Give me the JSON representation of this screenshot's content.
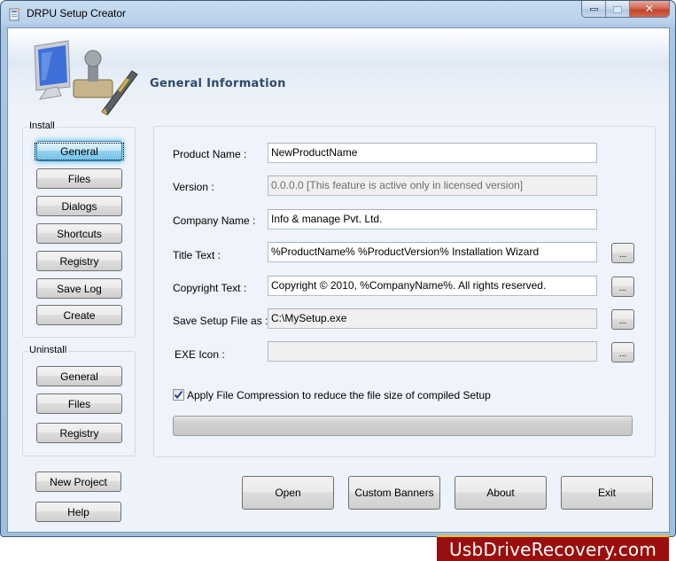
{
  "window": {
    "title": "DRPU Setup Creator",
    "controls": {
      "minimize": "minimize",
      "maximize": "maximize",
      "close": "close"
    }
  },
  "header": {
    "title": "General Information",
    "art_icons": [
      "monitor-icon",
      "stamp-icon",
      "pen-icon"
    ]
  },
  "sidebar": {
    "install": {
      "label": "Install",
      "items": [
        {
          "label": "General",
          "active": true
        },
        {
          "label": "Files"
        },
        {
          "label": "Dialogs"
        },
        {
          "label": "Shortcuts"
        },
        {
          "label": "Registry"
        },
        {
          "label": "Save Log"
        },
        {
          "label": "Create"
        }
      ]
    },
    "uninstall": {
      "label": "Uninstall",
      "items": [
        {
          "label": "General"
        },
        {
          "label": "Files"
        },
        {
          "label": "Registry"
        }
      ]
    },
    "new_project": "New Project",
    "help": "Help"
  },
  "form": {
    "product_name": {
      "label": "Product Name :",
      "value": "NewProductName"
    },
    "version": {
      "label": "Version :",
      "value": "0.0.0.0 [This feature is active only in licensed version]",
      "disabled": true
    },
    "company_name": {
      "label": "Company Name :",
      "value": "Info & manage Pvt. Ltd."
    },
    "title_text": {
      "label": "Title Text :",
      "value": "%ProductName% %ProductVersion% Installation Wizard",
      "browse": "..."
    },
    "copyright_text": {
      "label": "Copyright Text :",
      "value": "Copyright © 2010, %CompanyName%. All rights reserved.",
      "browse": "..."
    },
    "save_setup": {
      "label": "Save Setup File as :",
      "value": "C:\\MySetup.exe",
      "browse": "...",
      "disabled": true
    },
    "exe_icon": {
      "label": "EXE Icon :",
      "value": "",
      "browse": "...",
      "disabled": true
    },
    "compression": {
      "label": "Apply File Compression to reduce the file size of compiled Setup",
      "checked": true
    },
    "progress_percent": 0
  },
  "footer_buttons": {
    "open": "Open",
    "custom_banners": "Custom Banners",
    "about": "About",
    "exit": "Exit"
  },
  "watermark": "UsbDriveRecovery.com",
  "colors": {
    "accent_blue": "#6fc2ea",
    "header_title": "#2c4a6e",
    "watermark_bg": "#9b0e0e",
    "watermark_border": "#f3c516"
  }
}
